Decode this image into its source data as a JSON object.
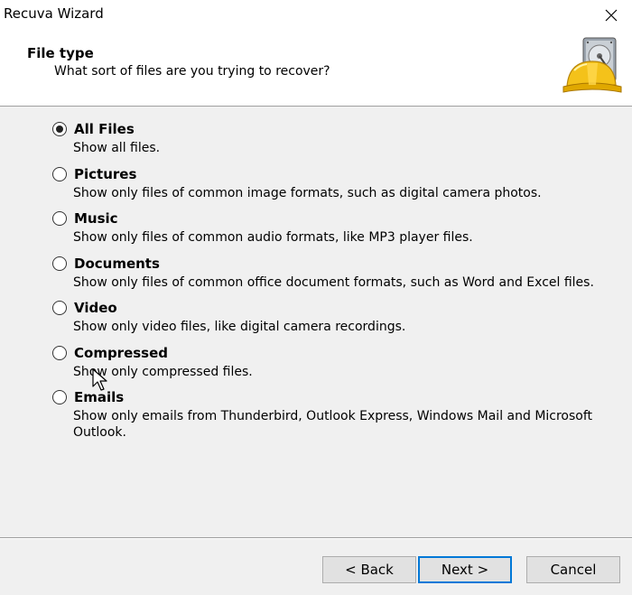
{
  "window": {
    "title": "Recuva Wizard"
  },
  "header": {
    "title": "File type",
    "subtitle": "What sort of files are you trying to recover?",
    "logo_icon": "recuva-hardhat-drive-icon"
  },
  "options": [
    {
      "label": "All Files",
      "description": "Show all files.",
      "selected": true
    },
    {
      "label": "Pictures",
      "description": "Show only files of common image formats, such as digital camera photos.",
      "selected": false
    },
    {
      "label": "Music",
      "description": "Show only files of common audio formats, like MP3 player files.",
      "selected": false
    },
    {
      "label": "Documents",
      "description": "Show only files of common office document formats, such as Word and Excel files.",
      "selected": false
    },
    {
      "label": "Video",
      "description": "Show only video files, like digital camera recordings.",
      "selected": false
    },
    {
      "label": "Compressed",
      "description": "Show only compressed files.",
      "selected": false
    },
    {
      "label": "Emails",
      "description": "Show only emails from Thunderbird, Outlook Express, Windows Mail and Microsoft Outlook.",
      "selected": false
    }
  ],
  "buttons": {
    "back": "< Back",
    "next": "Next >",
    "cancel": "Cancel"
  },
  "colors": {
    "default_button_border": "#0078d7",
    "window_bg": "#f0f0f0",
    "header_bg": "#ffffff"
  }
}
